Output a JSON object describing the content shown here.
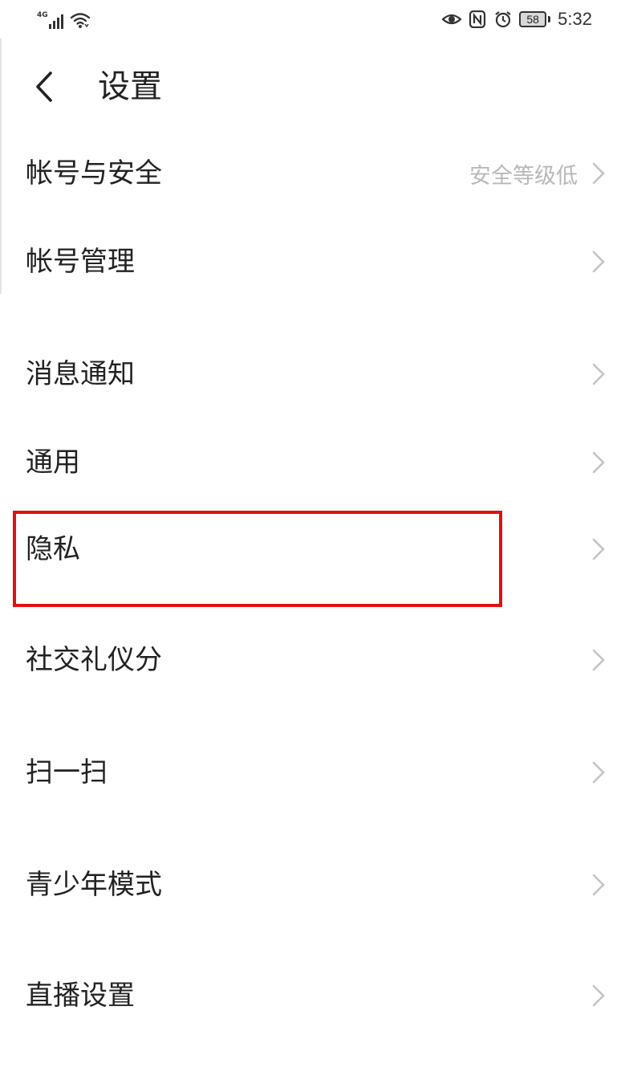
{
  "status_bar": {
    "network_label": "4G",
    "battery_level": "58",
    "time": "5:32",
    "icons": [
      "signal-icon",
      "wifi-icon",
      "eye-icon",
      "nfc-icon",
      "alarm-icon",
      "battery-icon"
    ]
  },
  "header": {
    "back_icon": "chevron-left-icon",
    "title": "设置"
  },
  "settings": [
    {
      "label": "帐号与安全",
      "value": "安全等级低"
    },
    {
      "label": "帐号管理",
      "value": ""
    },
    {
      "label": "消息通知",
      "value": ""
    },
    {
      "label": "通用",
      "value": ""
    },
    {
      "label": "隐私",
      "value": ""
    },
    {
      "label": "社交礼仪分",
      "value": ""
    },
    {
      "label": "扫一扫",
      "value": ""
    },
    {
      "label": "青少年模式",
      "value": ""
    },
    {
      "label": "直播设置",
      "value": ""
    }
  ],
  "colors": {
    "highlight": "#e01010",
    "secondary_text": "#b8b8b8",
    "chevron": "#c4c4c4"
  }
}
